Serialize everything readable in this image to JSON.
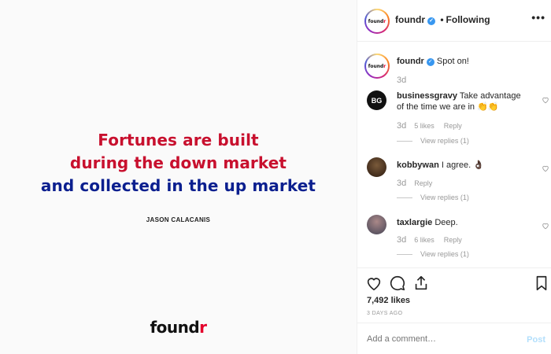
{
  "post_image": {
    "quote_line1": "Fortunes are built",
    "quote_line2": "during the down market",
    "quote_line3": "and collected in the up market",
    "author": "JASON CALACANIS",
    "brand_main": "found",
    "brand_accent": "r",
    "colors": {
      "red": "#c8102e",
      "navy": "#0b1f8f"
    }
  },
  "header": {
    "avatar_text": "found",
    "avatar_accent": "r",
    "username": "foundr",
    "separator": "•",
    "follow_status": "Following",
    "more": "•••"
  },
  "caption": {
    "username": "foundr",
    "text": "Spot on!",
    "when": "3d"
  },
  "comments": [
    {
      "username": "businessgravy",
      "avatar_text": "BG",
      "text": "Take advantage of the time we are in 👏👏",
      "when": "3d",
      "likes": "5 likes",
      "reply": "Reply",
      "view_replies": "View replies (1)"
    },
    {
      "username": "kobbywan",
      "text": "I agree. 👌🏿",
      "when": "3d",
      "reply": "Reply",
      "view_replies": "View replies (1)"
    },
    {
      "username": "taxlargie",
      "text": "Deep.",
      "when": "3d",
      "likes": "6 likes",
      "reply": "Reply",
      "view_replies": "View replies (1)"
    }
  ],
  "icons": [
    "heart-icon",
    "comment-icon",
    "share-icon",
    "bookmark-icon",
    "verified-icon",
    "more-icon"
  ],
  "engagement": {
    "likes": "7,492 likes",
    "date": "3 DAYS AGO"
  },
  "add_comment": {
    "placeholder": "Add a comment…",
    "post_label": "Post"
  }
}
